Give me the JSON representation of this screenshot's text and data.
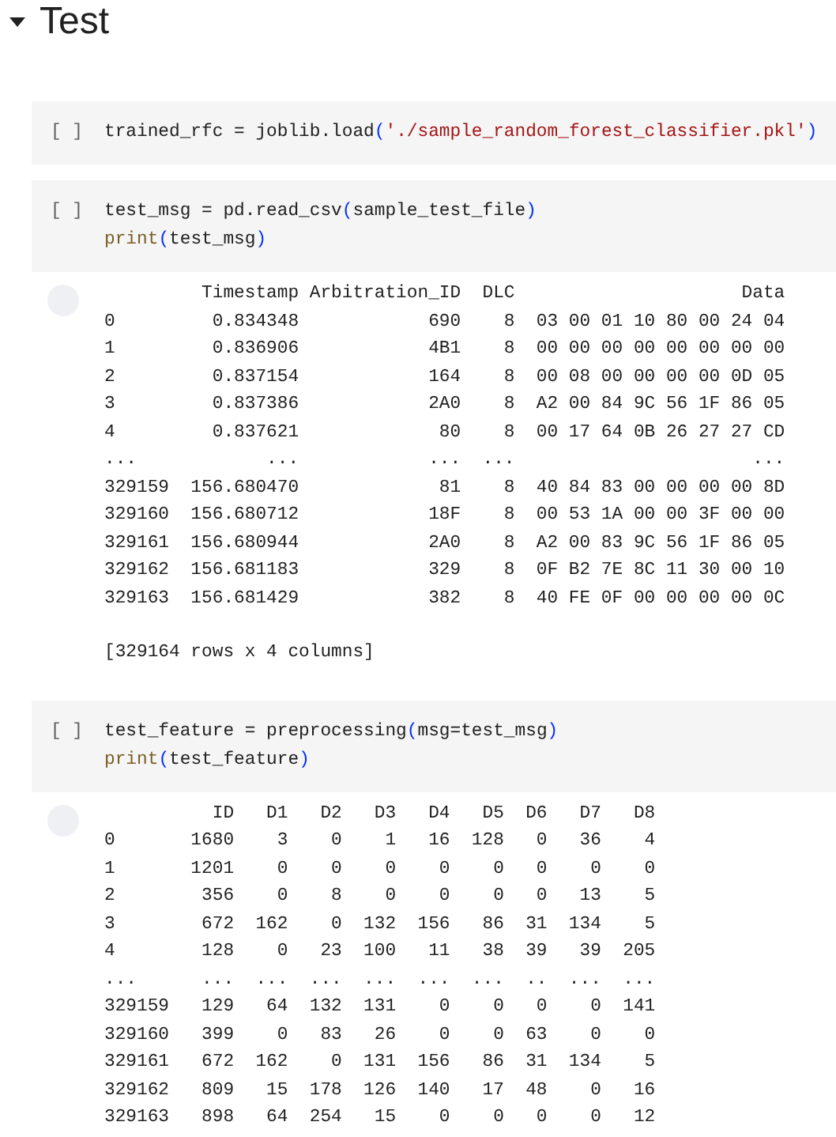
{
  "section": {
    "title": "Test",
    "expanded": true
  },
  "cells": [
    {
      "run_label": "[ ]",
      "code": [
        [
          {
            "kind": "text",
            "t": "trained_rfc = joblib.load"
          },
          {
            "kind": "bracket",
            "t": "("
          },
          {
            "kind": "string",
            "t": "'./sample_random_forest_classifier.pkl'"
          },
          {
            "kind": "bracket",
            "t": ")"
          }
        ]
      ]
    },
    {
      "run_label": "[ ]",
      "code": [
        [
          {
            "kind": "text",
            "t": "test_msg = pd.read_csv"
          },
          {
            "kind": "bracket",
            "t": "("
          },
          {
            "kind": "text",
            "t": "sample_test_file"
          },
          {
            "kind": "bracket",
            "t": ")"
          }
        ],
        [
          {
            "kind": "builtin",
            "t": "print"
          },
          {
            "kind": "bracket",
            "t": "("
          },
          {
            "kind": "text",
            "t": "test_msg"
          },
          {
            "kind": "bracket",
            "t": ")"
          }
        ]
      ],
      "output": {
        "table": [
          "         Timestamp Arbitration_ID  DLC                     Data",
          "0         0.834348            690    8  03 00 01 10 80 00 24 04",
          "1         0.836906            4B1    8  00 00 00 00 00 00 00 00",
          "2         0.837154            164    8  00 08 00 00 00 00 0D 05",
          "3         0.837386            2A0    8  A2 00 84 9C 56 1F 86 05",
          "4         0.837621             80    8  00 17 64 0B 26 27 27 CD",
          "...            ...            ...  ...                      ...",
          "329159  156.680470             81    8  40 84 83 00 00 00 00 8D",
          "329160  156.680712            18F    8  00 53 1A 00 00 3F 00 00",
          "329161  156.680944            2A0    8  A2 00 83 9C 56 1F 86 05",
          "329162  156.681183            329    8  0F B2 7E 8C 11 30 00 10",
          "329163  156.681429            382    8  40 FE 0F 00 00 00 00 0C"
        ],
        "summary": "[329164 rows x 4 columns]"
      }
    },
    {
      "run_label": "[ ]",
      "code": [
        [
          {
            "kind": "text",
            "t": "test_feature = preprocessing"
          },
          {
            "kind": "bracket",
            "t": "("
          },
          {
            "kind": "text",
            "t": "msg=test_msg"
          },
          {
            "kind": "bracket",
            "t": ")"
          }
        ],
        [
          {
            "kind": "builtin",
            "t": "print"
          },
          {
            "kind": "bracket",
            "t": "("
          },
          {
            "kind": "text",
            "t": "test_feature"
          },
          {
            "kind": "bracket",
            "t": ")"
          }
        ]
      ],
      "output": {
        "table": [
          "          ID   D1   D2   D3   D4   D5  D6   D7   D8",
          "0       1680    3    0    1   16  128   0   36    4",
          "1       1201    0    0    0    0    0   0    0    0",
          "2        356    0    8    0    0    0   0   13    5",
          "3        672  162    0  132  156   86  31  134    5",
          "4        128    0   23  100   11   38  39   39  205",
          "...      ...  ...  ...  ...  ...  ...  ..  ...  ...",
          "329159   129   64  132  131    0    0   0    0  141",
          "329160   399    0   83   26    0    0  63    0    0",
          "329161   672  162    0  131  156   86  31  134    5",
          "329162   809   15  178  126  140   17  48    0   16",
          "329163   898   64  254   15    0    0   0    0   12"
        ]
      }
    }
  ]
}
